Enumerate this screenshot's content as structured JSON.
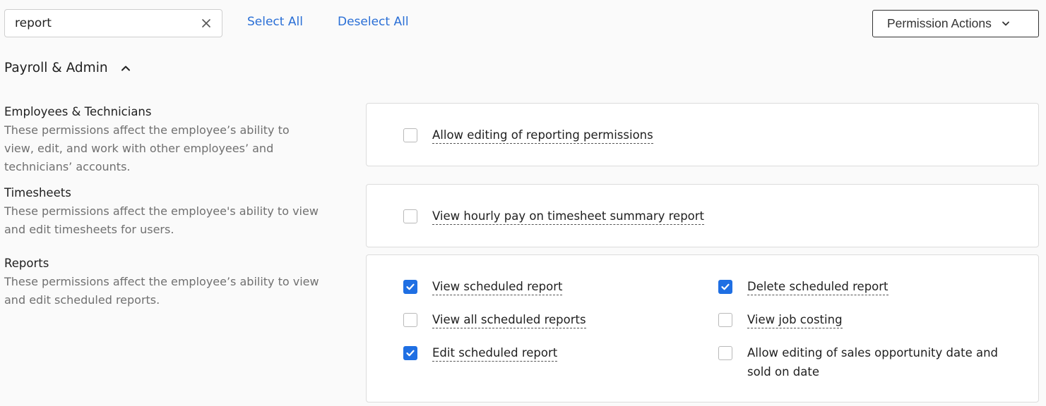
{
  "search": {
    "value": "report"
  },
  "toolbar": {
    "select_all": "Select All",
    "deselect_all": "Deselect All",
    "permission_actions": "Permission Actions"
  },
  "section": {
    "title": "Payroll & Admin"
  },
  "groups": [
    {
      "title": "Employees & Technicians",
      "description": "These permissions affect the employee’s ability to view, edit, and work with other employees’ and technicians’ accounts.",
      "permissions": [
        {
          "label": "Allow editing of reporting permissions",
          "checked": false
        }
      ]
    },
    {
      "title": "Timesheets",
      "description": "These permissions affect the employee's ability to view and edit timesheets for users.",
      "permissions": [
        {
          "label": "View hourly pay on timesheet summary report",
          "checked": false
        }
      ]
    },
    {
      "title": "Reports",
      "description": "These permissions affect the employee’s ability to view and edit scheduled reports.",
      "permissions": [
        {
          "label": "View scheduled report",
          "checked": true
        },
        {
          "label": "View all scheduled reports",
          "checked": false
        },
        {
          "label": "Edit scheduled report",
          "checked": true
        },
        {
          "label": "Delete scheduled report",
          "checked": true
        },
        {
          "label": "View job costing",
          "checked": false
        },
        {
          "label": "Allow editing of sales opportunity date and sold on date",
          "checked": false
        }
      ]
    }
  ],
  "colors": {
    "accent": "#2a6fd6",
    "checkbox_checked": "#1f6fe3"
  }
}
